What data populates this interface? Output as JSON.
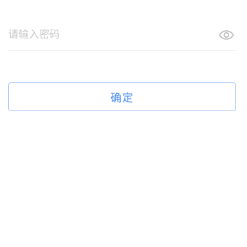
{
  "password_field": {
    "placeholder": "请输入密码",
    "value": "",
    "toggle_icon": "eye-icon"
  },
  "confirm_button": {
    "label": "确定"
  },
  "colors": {
    "placeholder": "#c8c8c8",
    "icon": "#b8b8b8",
    "divider": "#f1f1f1",
    "accent": "#4a8df0",
    "button_border": "#a9c8f5"
  }
}
